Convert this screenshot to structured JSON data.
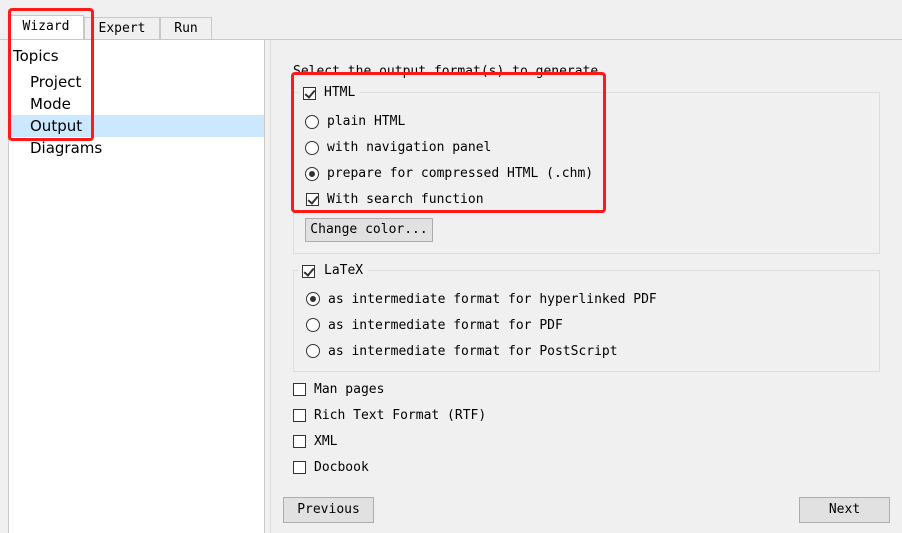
{
  "tabs": [
    "Wizard",
    "Expert",
    "Run"
  ],
  "tree": {
    "root": "Topics",
    "items": [
      "Project",
      "Mode",
      "Output",
      "Diagrams"
    ],
    "selected": "Output"
  },
  "main": {
    "heading": "Select the output format(s) to generate",
    "html_group": {
      "label": "HTML",
      "checked": true,
      "options": [
        "plain HTML",
        "with navigation panel",
        "prepare for compressed HTML (.chm)"
      ],
      "selected_option": "prepare for compressed HTML (.chm)",
      "search_label": "With search function",
      "search_checked": true,
      "color_button": "Change color..."
    },
    "latex_group": {
      "label": "LaTeX",
      "checked": true,
      "options": [
        "as intermediate format for hyperlinked PDF",
        "as intermediate format for PDF",
        "as intermediate format for PostScript"
      ],
      "selected_option": "as intermediate format for hyperlinked PDF"
    },
    "others": [
      {
        "label": "Man pages",
        "checked": false
      },
      {
        "label": "Rich Text Format (RTF)",
        "checked": false
      },
      {
        "label": "XML",
        "checked": false
      },
      {
        "label": "Docbook",
        "checked": false
      }
    ],
    "previous_button": "Previous",
    "next_button": "Next"
  },
  "highlight_color": "#ff1a1a",
  "selection_color": "#cce8ff"
}
